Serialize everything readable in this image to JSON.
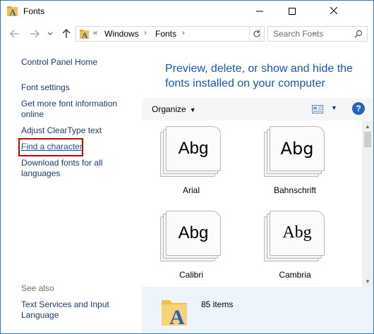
{
  "window": {
    "title": "Fonts"
  },
  "address": {
    "overflow": "«",
    "crumbs": [
      "Windows",
      "Fonts"
    ]
  },
  "search": {
    "placeholder": "Search Fonts"
  },
  "left_pane": {
    "links": [
      "Control Panel Home",
      "Font settings",
      "Get more font information online",
      "Adjust ClearType text",
      "Find a character",
      "Download fonts for all languages"
    ],
    "see_also_label": "See also",
    "see_also_links": [
      "Text Services and Input Language"
    ]
  },
  "main": {
    "heading": "Preview, delete, or show and hide the fonts installed on your computer",
    "organize_label": "Organize",
    "fonts": [
      {
        "name": "Arial",
        "sample": "Abg"
      },
      {
        "name": "Bahnschrift",
        "sample": "Abg"
      },
      {
        "name": "Calibri",
        "sample": "Abg"
      },
      {
        "name": "Cambria",
        "sample": "Abg"
      }
    ],
    "item_count": "85 items"
  },
  "colors": {
    "accent": "#1c56a8",
    "link": "#1a3b69",
    "highlight_border": "#c3000d",
    "details_bg": "#eef4fb"
  },
  "icons": {
    "app": "fonts-folder-icon",
    "minimize": "minimize-icon",
    "maximize": "maximize-icon",
    "close": "close-icon",
    "back": "back-arrow-icon",
    "forward": "forward-arrow-icon",
    "recent": "chevron-down-icon",
    "up": "up-arrow-icon",
    "refresh": "refresh-icon",
    "search": "search-icon",
    "help": "help-icon"
  }
}
